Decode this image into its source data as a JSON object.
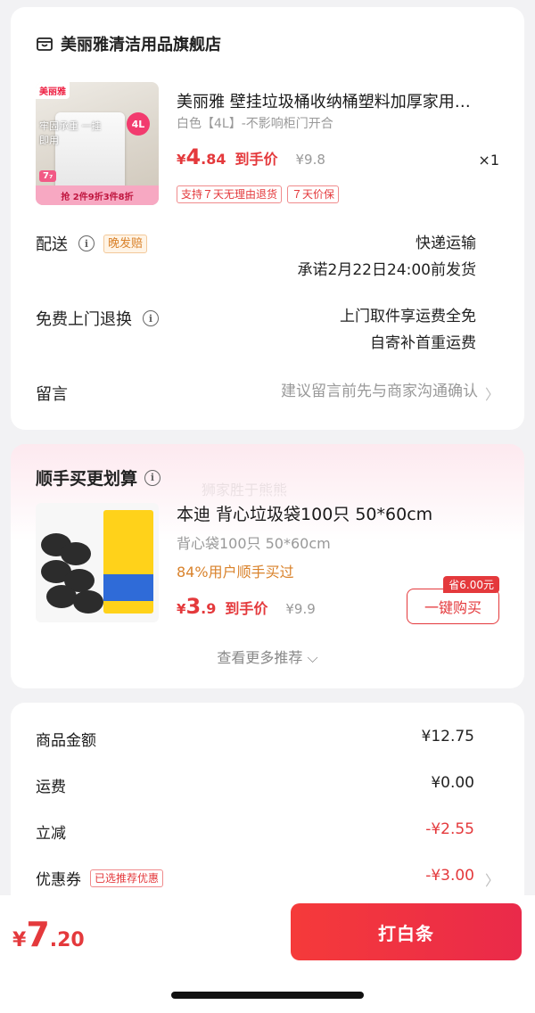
{
  "store": {
    "name": "美丽雅清洁用品旗舰店",
    "icon": "store-icon"
  },
  "product": {
    "image_texts": {
      "logo": "美丽雅",
      "badge": "4L",
      "feature": "牢固承重 一挂即用",
      "mini": "7₇",
      "promo": "抢 2件9折3件8折"
    },
    "title": "美丽雅 壁挂垃圾桶收纳桶塑料加厚家用…",
    "sku": "白色【4L】-不影响柜门开合",
    "price_yen": "¥",
    "price_int": "4",
    "price_dec": ".84",
    "price_suffix": "到手价",
    "original_price": "¥9.8",
    "quantity": "×1",
    "tags": [
      "支持７天无理由退货",
      "７天价保"
    ]
  },
  "delivery": {
    "label": "配送",
    "tag": "晚发赔",
    "line1": "快递运输",
    "line2": "承诺2月22日24:00前发货"
  },
  "return_service": {
    "label": "免费上门退换",
    "line1": "上门取件享运费全免",
    "line2": "自寄补首重运费"
  },
  "message": {
    "label": "留言",
    "placeholder": "建议留言前先与商家沟通确认"
  },
  "recommend": {
    "title": "顺手买更划算",
    "watermark": "狮家胜于熊熊",
    "name": "本迪 背心垃圾袋100只 50*60cm",
    "sku": "背心袋100只 50*60cm",
    "sold": "84%用户顺手买过",
    "price_yen": "¥",
    "price_int": "3",
    "price_dec": ".9",
    "price_suffix": "到手价",
    "original_price": "¥9.9",
    "save_badge": "省6.00元",
    "buy_label": "一键购买",
    "more": "查看更多推荐"
  },
  "summary": {
    "rows": [
      {
        "label": "商品金额",
        "value": "¥12.75"
      },
      {
        "label": "运费",
        "value": "¥0.00"
      },
      {
        "label": "立减",
        "value": "-¥2.55"
      },
      {
        "label": "优惠券",
        "value": "-¥3.00",
        "tag": "已选推荐优惠"
      }
    ]
  },
  "footer": {
    "total_yen": "¥",
    "total_int": "7",
    "total_dec": ".20",
    "pay_label": "打白条"
  },
  "colors": {
    "accent": "#e4393c",
    "background": "#f2f2f4",
    "warning": "#d9822b"
  }
}
